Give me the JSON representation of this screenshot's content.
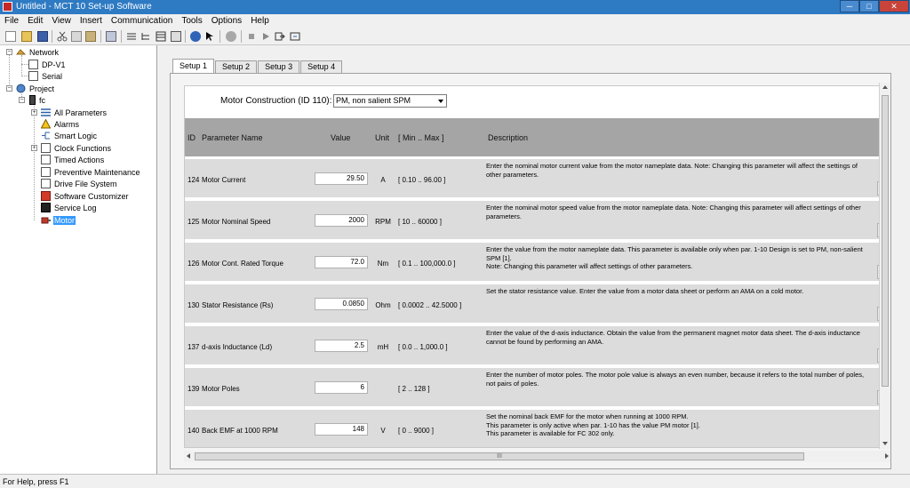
{
  "window": {
    "title": "Untitled - MCT 10 Set-up Software",
    "min_glyph": "─",
    "max_glyph": "□",
    "close_glyph": "✕"
  },
  "menu": [
    "File",
    "Edit",
    "View",
    "Insert",
    "Communication",
    "Tools",
    "Options",
    "Help"
  ],
  "tree": {
    "network": "Network",
    "dpv1": "DP-V1",
    "serial": "Serial",
    "project": "Project",
    "fc": "fc",
    "items": {
      "all_parameters": "All Parameters",
      "alarms": "Alarms",
      "smart_logic": "Smart Logic",
      "clock_functions": "Clock Functions",
      "timed_actions": "Timed Actions",
      "preventive_maintenance": "Preventive Maintenance",
      "drive_file_system": "Drive File System",
      "software_customizer": "Software Customizer",
      "service_log": "Service Log",
      "motor": "Motor"
    },
    "expand_glyph": "+",
    "collapse_glyph": "−"
  },
  "tabs": [
    "Setup 1",
    "Setup 2",
    "Setup 3",
    "Setup 4"
  ],
  "motor_construction": {
    "label": "Motor Construction (ID 110):",
    "value": "PM, non salient SPM"
  },
  "headers": {
    "id": "ID",
    "name": "Parameter Name",
    "value": "Value",
    "unit": "Unit",
    "range": "[ Min .. Max ]",
    "description": "Description"
  },
  "rows": [
    {
      "id": "124",
      "name": "Motor Current",
      "value": "29.50",
      "unit": "A",
      "range": "[ 0.10 .. 96.00 ]",
      "description": "Enter the nominal motor current value from the motor nameplate data. Note: Changing this parameter will affect the settings of other parameters."
    },
    {
      "id": "125",
      "name": "Motor Nominal Speed",
      "value": "2000",
      "unit": "RPM",
      "range": "[ 10 .. 60000 ]",
      "description": "Enter the nominal motor speed value from the motor nameplate data. Note: Changing this parameter will affect settings of other parameters."
    },
    {
      "id": "126",
      "name": "Motor Cont. Rated Torque",
      "value": "72.0",
      "unit": "Nm",
      "range": "[ 0.1 .. 100,000.0 ]",
      "description": "Enter the value from the motor nameplate data. This parameter is available only when par. 1-10 Design is set to PM, non-salient SPM [1].\nNote: Changing this parameter will affect settings of other parameters."
    },
    {
      "id": "130",
      "name": "Stator Resistance (Rs)",
      "value": "0.0850",
      "unit": "Ohm",
      "range": "[ 0.0002 .. 42.5000 ]",
      "description": "Set the stator resistance value. Enter the value from a motor data sheet or perform an AMA on a cold motor."
    },
    {
      "id": "137",
      "name": "d-axis Inductance (Ld)",
      "value": "2.5",
      "unit": "mH",
      "range": "[ 0.0 .. 1,000.0 ]",
      "description": "Enter the value of the d-axis inductance. Obtain the value from the permanent magnet motor data sheet. The d-axis inductance cannot be found by performing an AMA."
    },
    {
      "id": "139",
      "name": "Motor Poles",
      "value": "6",
      "unit": "",
      "range": "[ 2 .. 128 ]",
      "description": "Enter the number of motor poles. The motor pole value is always an even number, because it refers to the total number of poles, not pairs of poles."
    },
    {
      "id": "140",
      "name": "Back EMF at 1000 RPM",
      "value": "148",
      "unit": "V",
      "range": "[ 0 .. 9000 ]",
      "description": "Set the nominal back EMF for the motor when running at 1000 RPM.\nThis parameter is only active when par. 1-10 has the value PM motor [1].\nThis parameter is available for FC 302 only."
    }
  ],
  "scroll": {
    "h_grip": "III"
  },
  "status": "For Help, press F1",
  "colors": {
    "titlebar": "#2e7ac3",
    "header": "#a5a5a5",
    "row": "#dcdcdc",
    "selection": "#3399ff"
  }
}
